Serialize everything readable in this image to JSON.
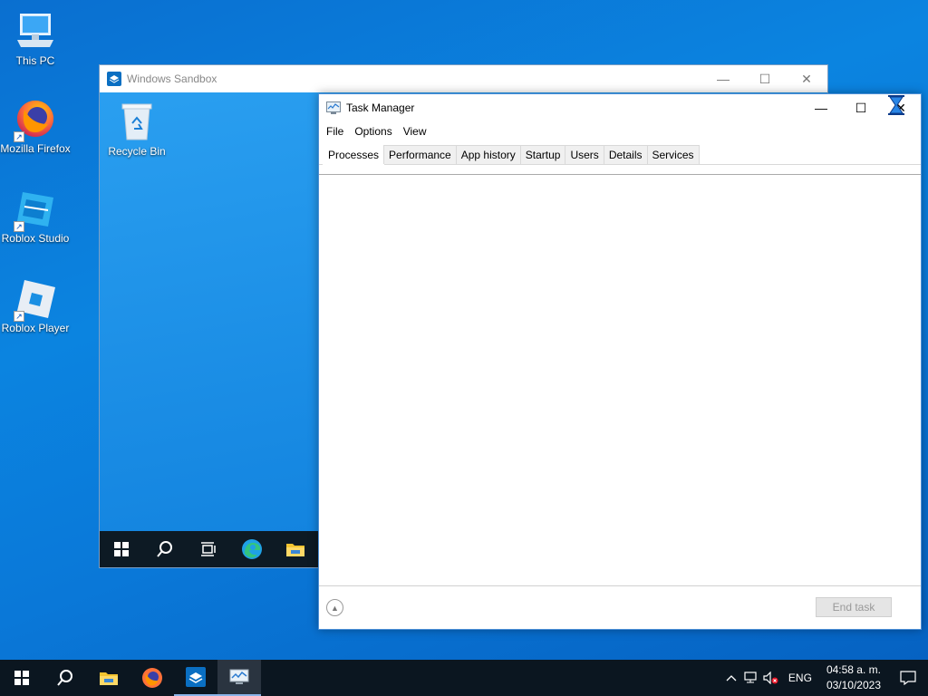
{
  "desktop": {
    "icons": [
      {
        "label": "This PC",
        "icon": "computer-icon"
      },
      {
        "label": "Mozilla Firefox",
        "icon": "firefox-icon"
      },
      {
        "label": "Roblox Studio",
        "icon": "roblox-studio-icon"
      },
      {
        "label": "Roblox Player",
        "icon": "roblox-player-icon"
      }
    ]
  },
  "sandbox": {
    "title": "Windows Sandbox",
    "recycle_bin": "Recycle Bin",
    "window_controls": {
      "minimize": "—",
      "maximize": "☐",
      "close": "✕"
    }
  },
  "taskmgr": {
    "title": "Task Manager",
    "menu": [
      "File",
      "Options",
      "View"
    ],
    "tabs": [
      "Processes",
      "Performance",
      "App history",
      "Startup",
      "Users",
      "Details",
      "Services"
    ],
    "active_tab": "Processes",
    "end_task": "End task",
    "window_controls": {
      "minimize": "—",
      "maximize": "☐",
      "close": "✕"
    }
  },
  "taskbar": {
    "tray": {
      "language": "ENG",
      "time": "04:58 a. m.",
      "date": "03/10/2023"
    }
  },
  "colors": {
    "desktop_bg": "#0a78d8",
    "taskbar_bg": "#0b1620",
    "accent": "#0078d7"
  }
}
